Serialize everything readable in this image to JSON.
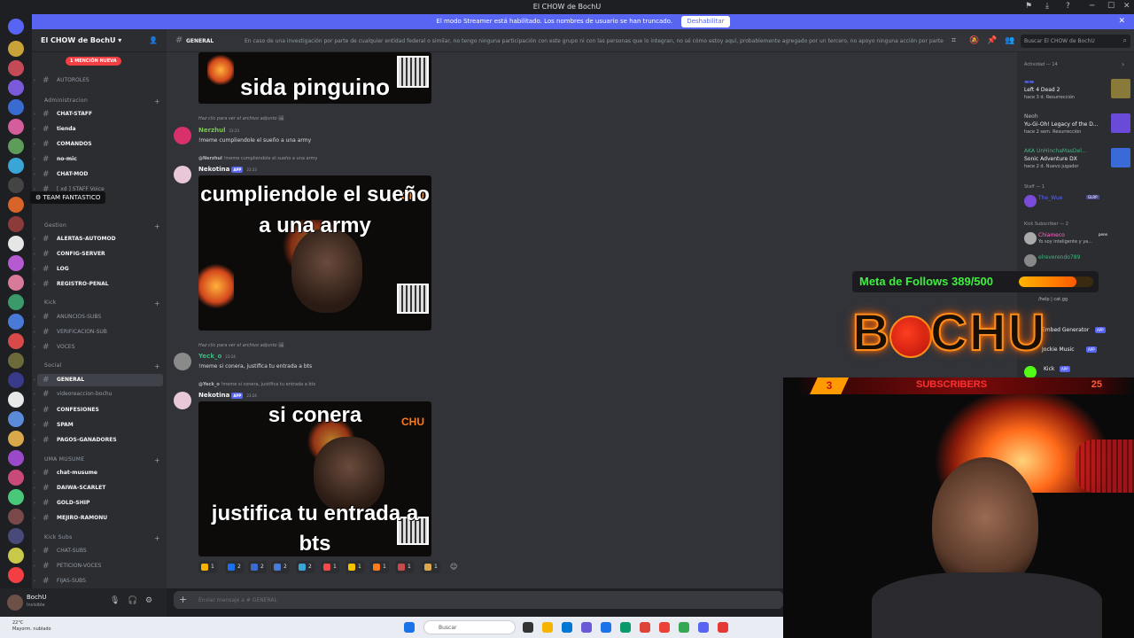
{
  "window": {
    "title": "El CHOW de BochU"
  },
  "banner": {
    "text": "El modo Streamer está habilitado. Los nombres de usuario se han truncado.",
    "button": "Deshabilitar"
  },
  "server": {
    "name": "El CHOW de BochU",
    "mention_pill": "1 MENCIÓN NUEVA",
    "tooltip": "TEAM FANTASTICO"
  },
  "channels": [
    {
      "label": "AUTOROLES",
      "type": "ch"
    },
    {
      "label": "Administracion",
      "type": "cat"
    },
    {
      "label": "CHAT-STAFF",
      "type": "ch"
    },
    {
      "label": "tienda",
      "type": "ch"
    },
    {
      "label": "COMANDOS",
      "type": "ch"
    },
    {
      "label": "no-mic",
      "type": "ch"
    },
    {
      "label": "CHAT-MOD",
      "type": "ch"
    },
    {
      "label": "[ xd ] STAFF Voice",
      "type": "ch"
    },
    {
      "label": "Gestion",
      "type": "cat"
    },
    {
      "label": "ALERTAS-AUTOMOD",
      "type": "ch"
    },
    {
      "label": "CONFIG-SERVER",
      "type": "ch"
    },
    {
      "label": "LOG",
      "type": "ch"
    },
    {
      "label": "REGISTRO-PENAL",
      "type": "ch"
    },
    {
      "label": "Kick",
      "type": "cat"
    },
    {
      "label": "ANUNCIOS-SUBS",
      "type": "ch"
    },
    {
      "label": "VERIFICACION-SUB",
      "type": "ch"
    },
    {
      "label": "VOCES",
      "type": "ch"
    },
    {
      "label": "Social",
      "type": "cat"
    },
    {
      "label": "GENERAL",
      "type": "ch"
    },
    {
      "label": "videoreaccion-bochu",
      "type": "ch"
    },
    {
      "label": "CONFESIONES",
      "type": "ch"
    },
    {
      "label": "SPAM",
      "type": "ch"
    },
    {
      "label": "PAGOS-GANADORES",
      "type": "ch"
    },
    {
      "label": "UMA MUSUME",
      "type": "cat"
    },
    {
      "label": "chat-musume",
      "type": "ch"
    },
    {
      "label": "DAIWA-SCARLET",
      "type": "ch"
    },
    {
      "label": "GOLD-SHIP",
      "type": "ch"
    },
    {
      "label": "MEJIRO-RAMONU",
      "type": "ch"
    },
    {
      "label": "Kick Subs",
      "type": "cat"
    },
    {
      "label": "CHAT-SUBS",
      "type": "ch"
    },
    {
      "label": "PETICION-VOCES",
      "type": "ch"
    },
    {
      "label": "FIJAS-SUBS",
      "type": "ch"
    }
  ],
  "user": {
    "name": "BochU",
    "status": "Invisible"
  },
  "header": {
    "channel": "GENERAL",
    "topic": "En caso de una investigación por parte de cualquier entidad federal o similar, no tengo ninguna participación con este grupo ni con las personas que lo integran, no sé cómo estoy aquí, probablemente agregado por un tercero, no apoyo ninguna acción por parte de...",
    "search_placeholder": "Buscar El CHOW de BochU"
  },
  "messages": {
    "meme1": "sida pinguino",
    "m1_reply": "Haz clic para ver el archivo adjunto",
    "m1_author": "Nerzhul",
    "m1_time": "23:23",
    "m1_text": "!meme cumpliendole el sueño a una army",
    "m2_reply_user": "@Nerzhul",
    "m2_reply": "!meme cumpliendole el sueño a una army",
    "m2_author": "Nekotina",
    "m2_app": "APP",
    "m2_time": "23:23",
    "meme2": "cumpliendole el sueño a una army",
    "m3_reply": "Haz clic para ver el archivo adjunto",
    "m3_author": "Yeck_o",
    "m3_time": "23:24",
    "m3_text": "!meme si conera, justifica tu entrada a bts",
    "m4_reply_user": "@Yeck_o",
    "m4_reply": "!meme si conera, justifica tu entrada a bts",
    "m4_author": "Nekotina",
    "m4_app": "APP",
    "m4_time": "23:24",
    "meme3_top": "si conera",
    "meme3_bottom": "justifica tu entrada a bts",
    "meme_brand": "CHU"
  },
  "reactions": [
    "1",
    "2",
    "2",
    "2",
    "2",
    "1",
    "1",
    "1",
    "1",
    "1"
  ],
  "compose": {
    "placeholder": "Enviar mensaje a #  GENERAL"
  },
  "members": {
    "activity": "Actividad — 14",
    "a1_game": "Left 4 Dead 2",
    "a1_sub": "hace 3 d.  Resurrección",
    "a2_name": "Neoh",
    "a2_game": "Yu-Gi-Oh! Legacy of the D...",
    "a2_sub": "hace 2 sem.  Resurrección",
    "a3_name": "AKA UnHinchaMasDel...",
    "a3_game": "Sonic Adventure DX",
    "a3_sub": "hace 2 d.  Nuevo jugador",
    "staff": "Staff — 1",
    "staff1": "The_Wue",
    "staff1_tag": "GLRP",
    "kick": "Kick Subscriber — 2",
    "k1": "Chiameco",
    "k1_tag": "pene",
    "k1_sub": "Yo soy inteligente y ya...",
    "k2": "elreverendo789",
    "b1_sub": "/help | cat.gg",
    "b2": "Embed Generator",
    "b2_app": "APP",
    "b3": "Jockie Music",
    "b3_app": "APP",
    "b4": "Kick",
    "b4_app": "APP"
  },
  "overlay": {
    "goal_text": "Meta de Follows 389/500",
    "goal_fraction": 0.778,
    "logo": [
      "B",
      "CHU"
    ],
    "subs_count": "3",
    "subs_label": "SUBSCRIBERS",
    "subs_goal": "25"
  },
  "taskbar": {
    "temp": "22°C",
    "weather": "Mayorm. nublado",
    "search": "Buscar"
  }
}
